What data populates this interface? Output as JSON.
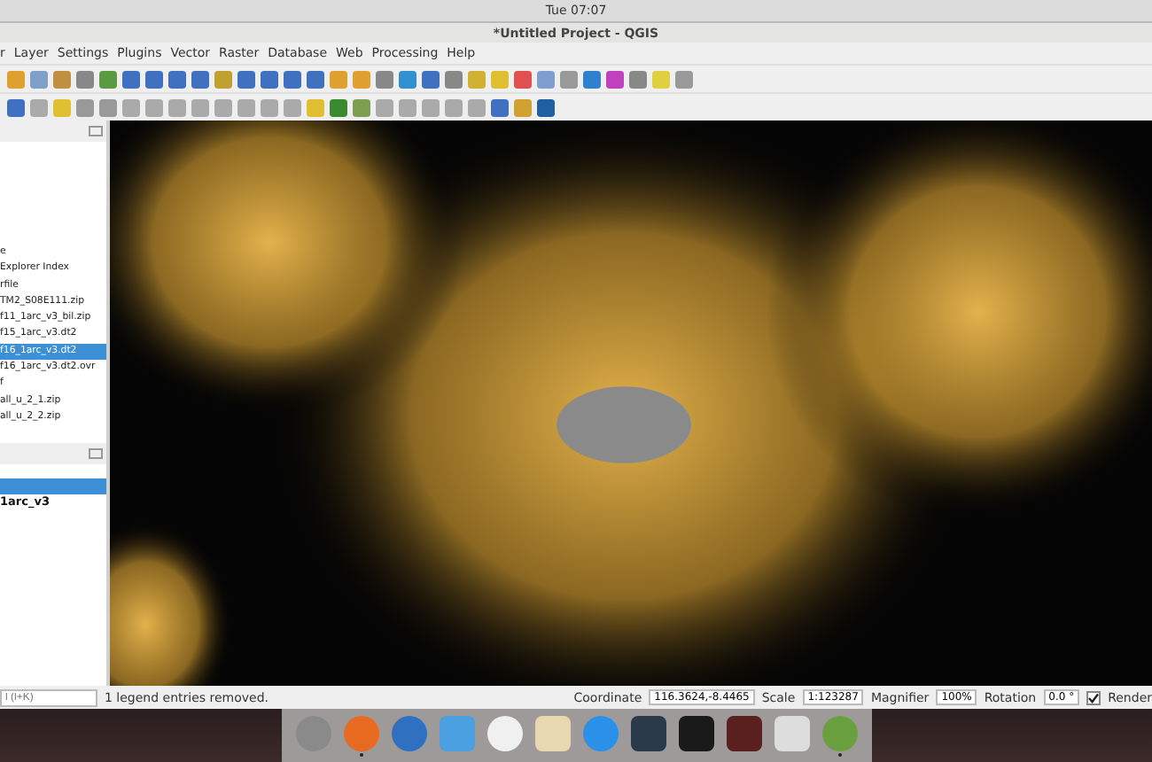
{
  "top_bar": {
    "clock": "Tue 07:07"
  },
  "window": {
    "title": "*Untitled Project - QGIS"
  },
  "menu": [
    "r",
    "Layer",
    "Settings",
    "Plugins",
    "Vector",
    "Raster",
    "Database",
    "Web",
    "Processing",
    "Help"
  ],
  "browser_panel": {
    "items": [
      {
        "label": "e",
        "selected": false
      },
      {
        "label": "Explorer Index",
        "selected": false
      },
      {
        "label": "rfile",
        "selected": false
      },
      {
        "label": "TM2_S08E111.zip",
        "selected": false
      },
      {
        "label": "f11_1arc_v3_bil.zip",
        "selected": false
      },
      {
        "label": "f15_1arc_v3.dt2",
        "selected": false
      },
      {
        "label": "f16_1arc_v3.dt2",
        "selected": true
      },
      {
        "label": "f16_1arc_v3.dt2.ovr",
        "selected": false
      },
      {
        "label": "f",
        "selected": false
      },
      {
        "label": "all_u_2_1.zip",
        "selected": false
      },
      {
        "label": "all_u_2_2.zip",
        "selected": false
      }
    ]
  },
  "layers_panel": {
    "items": [
      {
        "selected": true
      },
      {
        "label": "1arc_v3",
        "selected": false
      }
    ]
  },
  "status_bar": {
    "search_placeholder": "l (l+K)",
    "message": "1 legend entries removed.",
    "coordinate_label": "Coordinate",
    "coordinate": "116.3624,-8.4465",
    "scale_label": "Scale",
    "scale": "1:123287",
    "magnifier_label": "Magnifier",
    "magnifier": "100%",
    "rotation_label": "Rotation",
    "rotation": "0.0 °",
    "render_label": "Render",
    "render_checked": true
  },
  "dock": [
    {
      "kind": "rocket",
      "running": false
    },
    {
      "kind": "browser",
      "running": true
    },
    {
      "kind": "mail",
      "running": false
    },
    {
      "kind": "finder",
      "running": false
    },
    {
      "kind": "music",
      "running": false
    },
    {
      "kind": "notes",
      "running": false
    },
    {
      "kind": "store",
      "running": false
    },
    {
      "kind": "dots",
      "running": false
    },
    {
      "kind": "terminal",
      "running": false
    },
    {
      "kind": "record",
      "running": false
    },
    {
      "kind": "image",
      "running": false
    },
    {
      "kind": "map",
      "running": true
    }
  ]
}
